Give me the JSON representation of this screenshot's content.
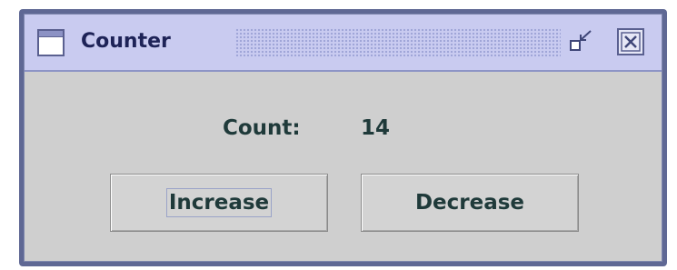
{
  "window": {
    "title": "Counter",
    "icons": {
      "app": "window-icon",
      "restore": "restore-icon",
      "close": "close-icon"
    },
    "colors": {
      "titlebar": "#c9cbf0",
      "frame": "#5f6894",
      "body": "#cfcfcf",
      "text": "#1f3a3a"
    }
  },
  "counter": {
    "label": "Count:",
    "value": "14"
  },
  "buttons": {
    "increase": "Increase",
    "decrease": "Decrease"
  }
}
